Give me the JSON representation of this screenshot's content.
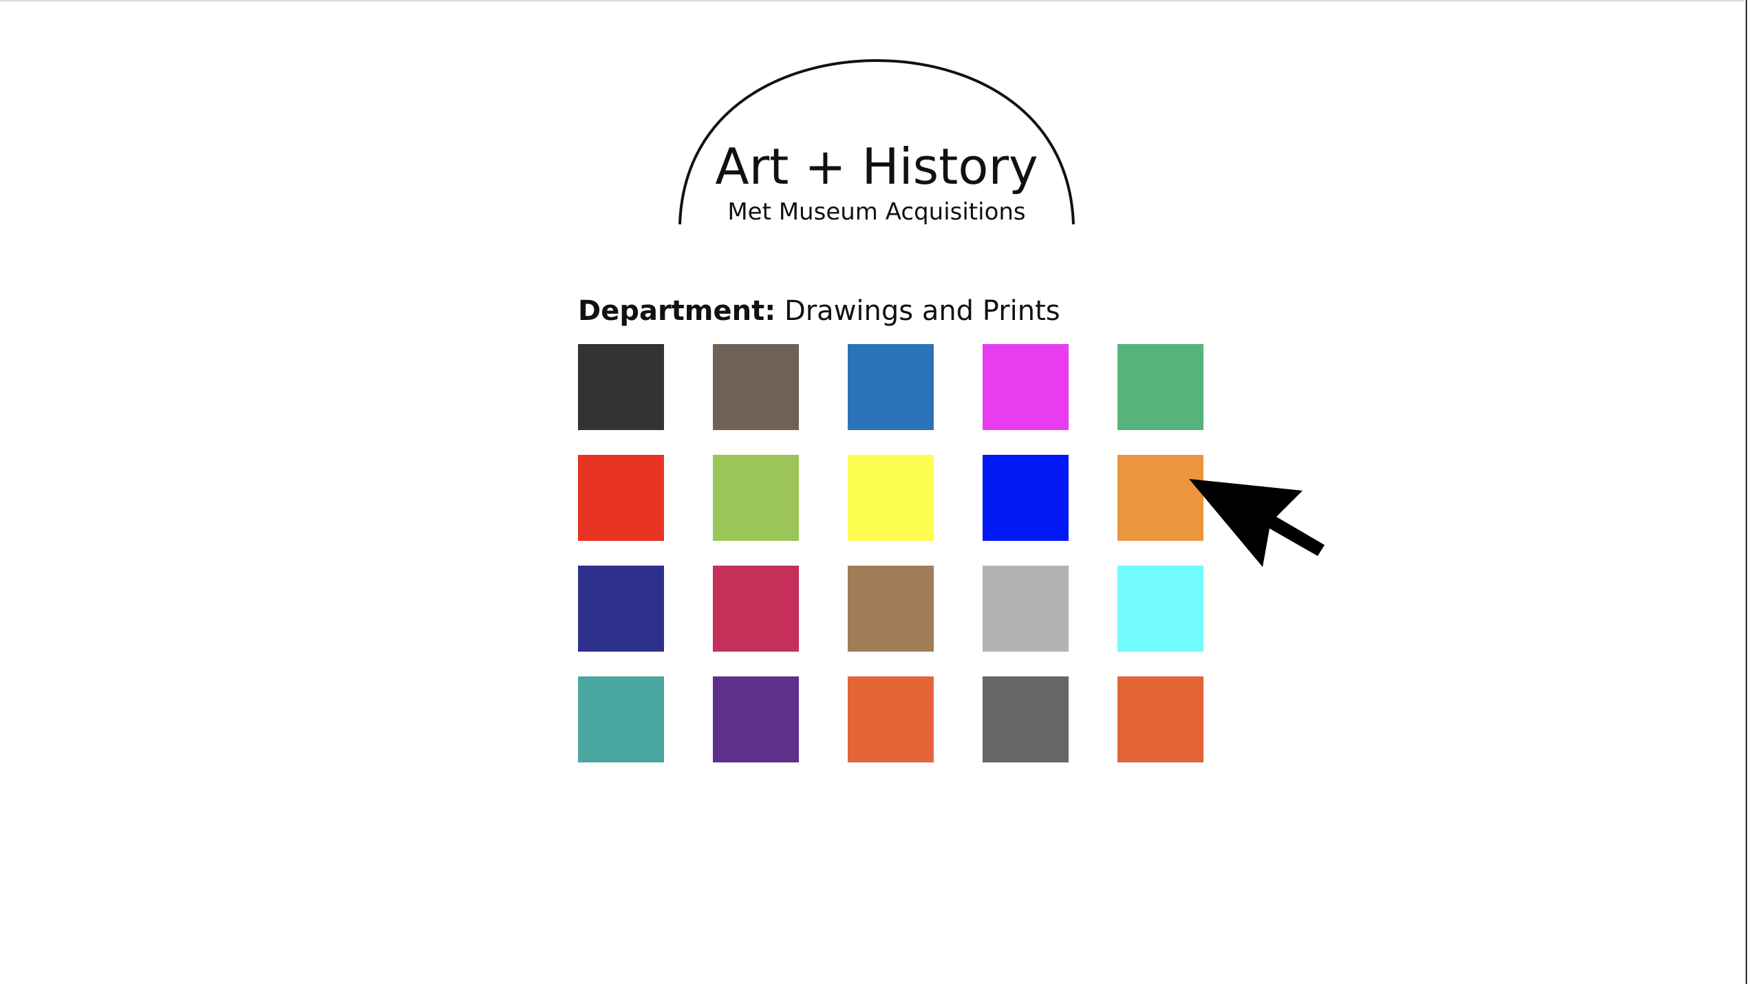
{
  "header": {
    "title": "Art + History",
    "subtitle": "Met Museum Acquisitions"
  },
  "department": {
    "label": "Department:",
    "value": "Drawings and Prints"
  },
  "swatches": [
    [
      "#333333",
      "#706157",
      "#2b73b8",
      "#e93cf0",
      "#56b37b"
    ],
    [
      "#e93423",
      "#9bc556",
      "#fdfd52",
      "#0019f4",
      "#eb963f"
    ],
    [
      "#2e318c",
      "#c4305a",
      "#a07c58",
      "#b3b3b3",
      "#71fbfc"
    ],
    [
      "#4aa79f",
      "#5d318a",
      "#e36537",
      "#676767",
      "#e36537"
    ]
  ],
  "cursor": {
    "icon": "arrow-cursor-icon",
    "color": "#000000"
  }
}
